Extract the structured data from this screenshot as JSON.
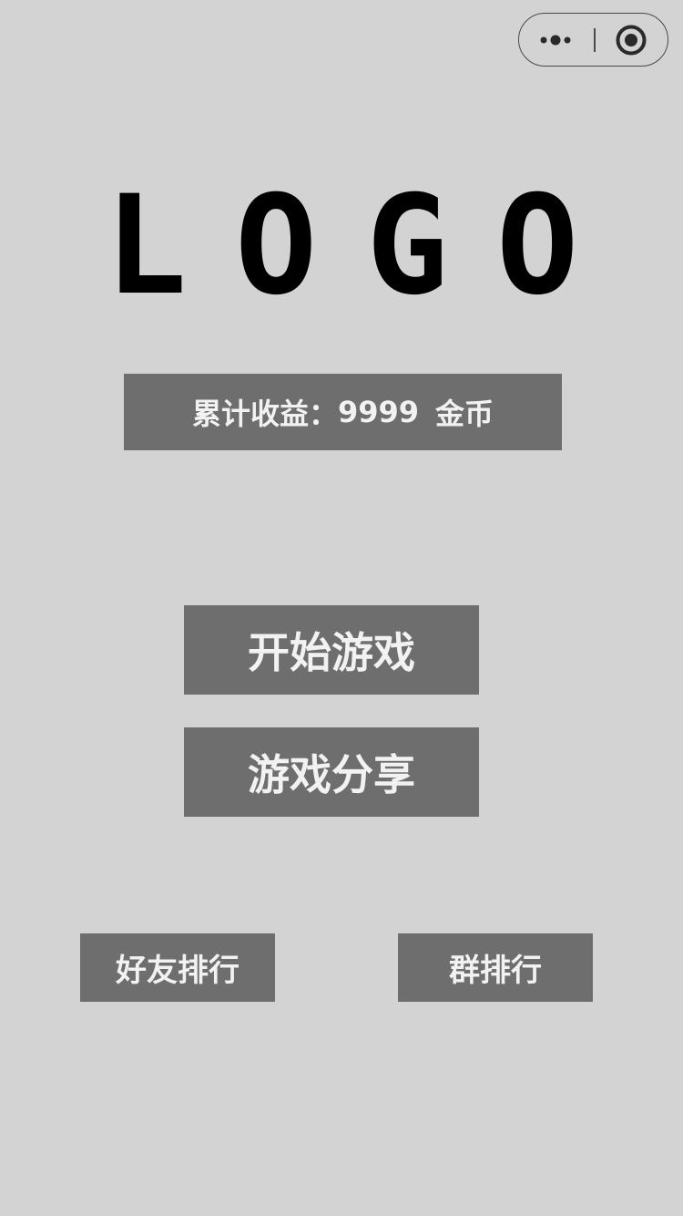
{
  "capsule": {
    "more_icon": "more-dots-icon",
    "close_icon": "target-circle-icon"
  },
  "logo": {
    "letters": [
      "L",
      "O",
      "G",
      "O"
    ]
  },
  "earnings": {
    "label": "累计收益：",
    "value": "9999",
    "unit": "金币"
  },
  "buttons": {
    "start": "开始游戏",
    "share": "游戏分享",
    "friends_rank": "好友排行",
    "group_rank": "群排行"
  },
  "colors": {
    "background": "#d3d3d3",
    "button": "#6e6e6e",
    "button_text": "#f2f2f2",
    "logo": "#000000"
  }
}
